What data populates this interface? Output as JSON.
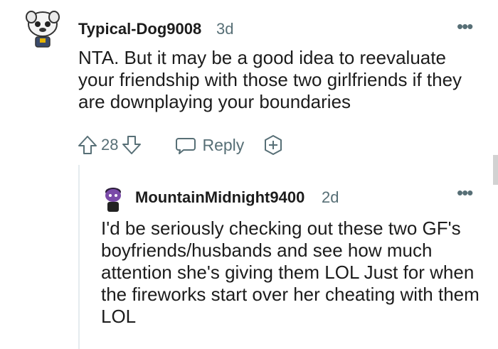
{
  "comment": {
    "author": "Typical-Dog9008",
    "age": "3d",
    "body": "NTA. But it may be a good idea to reevaluate your friendship with those two girlfriends if they are downplaying your boundaries",
    "actions": {
      "upvote_icon": "arrow-up-outline-icon",
      "score": "28",
      "downvote_icon": "arrow-down-outline-icon",
      "reply_icon": "speech-bubble-icon",
      "reply_label": "Reply",
      "award_icon": "plus-badge-icon"
    },
    "menu_icon": "more-dots-icon"
  },
  "reply": {
    "author": "MountainMidnight9400",
    "age": "2d",
    "body": "I'd be seriously checking out these two GF's boyfriends/husbands and see how much attention she's giving them LOL Just for when the fireworks start over her cheating with them LOL",
    "menu_icon": "more-dots-icon"
  },
  "colors": {
    "text": "#1c1c1c",
    "meta": "#576f76",
    "thread_line": "#e5ebee"
  }
}
